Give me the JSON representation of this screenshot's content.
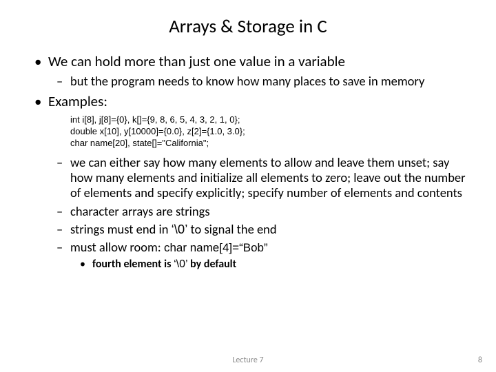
{
  "title": "Arrays & Storage in C",
  "bullets": {
    "dot": "•",
    "dash": "–"
  },
  "p1": "We can hold more than just one value in a variable",
  "p1a": "but the program needs to know how many places to save in memory",
  "p2": "Examples:",
  "code": {
    "l1": "int i[8], j[8]={0}, k[]={9, 8, 6, 5, 4, 3, 2, 1, 0};",
    "l2": "double x[10], y[10000]={0.0}, z[2]={1.0, 3.0};",
    "l3": "char name[20], state[]=\"California\";"
  },
  "p2a": "we can either say how many elements to allow and leave them unset; say how many elements and initialize all elements to zero; leave out the number of elements and specify explicitly; specify number of elements and contents",
  "p2b": "character arrays are strings",
  "p2c_pre": "strings must end in ",
  "p2c_code": "‘\\0’",
  "p2c_post": " to signal the end",
  "p2d_pre": "must allow room: ",
  "p2d_code": "char name[4]=“Bob”",
  "p3_pre": "fourth element is ",
  "p3_code": "‘\\0’",
  "p3_post": " by default",
  "footer": {
    "center": "Lecture 7",
    "right": "8"
  }
}
